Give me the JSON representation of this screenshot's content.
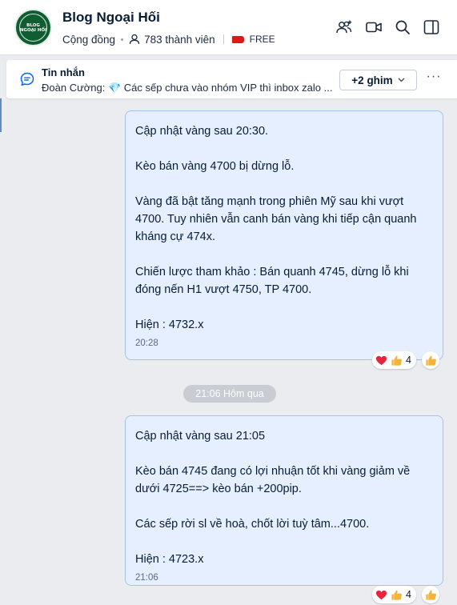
{
  "header": {
    "title": "Blog Ngoại Hối",
    "avatar_text_1": "BLOG",
    "avatar_text_2": "NGOẠI HỐI",
    "type": "Cộng đồng",
    "members": "783 thành viên",
    "tag": "FREE"
  },
  "pinned": {
    "title": "Tin nhắn",
    "text": "Đoàn Cường: 💎 Các sếp chưa vào nhóm VIP thì inbox zalo ...",
    "pins_button": "+2 ghim"
  },
  "messages": [
    {
      "lines": [
        "Cập nhật vàng sau 20:30.",
        "",
        "Kèo bán vàng 4700 bị dừng lỗ.",
        "",
        "Vàng đã bật tăng mạnh trong phiên Mỹ sau khi vượt 4700. Tuy nhiên vẫn canh bán vàng khi tiếp cận quanh kháng cự 474x.",
        "",
        "Chiến lược tham khảo : Bán quanh 4745, dừng lỗ khi đóng nến H1 vượt 4750, TP 4700.",
        "",
        "Hiện : 4732.x"
      ],
      "time": "20:28",
      "reaction_count": "4"
    },
    {
      "lines": [
        "Cập nhật vàng sau 21:05",
        "",
        "Kèo bán 4745 đang có lợi nhuận tốt khi vàng giảm về dưới 4725==> kèo bán +200pip.",
        "",
        "Các sếp rời sl về hoà, chốt lời tuỳ tâm...4700.",
        "",
        "Hiện : 4723.x"
      ],
      "time": "21:06",
      "reaction_count": "4"
    }
  ],
  "date_separator": "21:06 Hôm qua",
  "icons": [
    "add-member-icon",
    "video-call-icon",
    "search-icon",
    "sidebar-toggle-icon",
    "chat-bubble-icon",
    "chevron-down-icon",
    "more-icon",
    "heart-icon",
    "thumbs-up-icon",
    "person-icon",
    "tag-icon"
  ],
  "colors": {
    "bubble_bg": "#e5efff",
    "bubble_border": "#a6c3ee",
    "background": "#ebecf0",
    "free_tag": "#d91b1b",
    "heart": "#e5263d",
    "thumb": "#f3b43c"
  }
}
